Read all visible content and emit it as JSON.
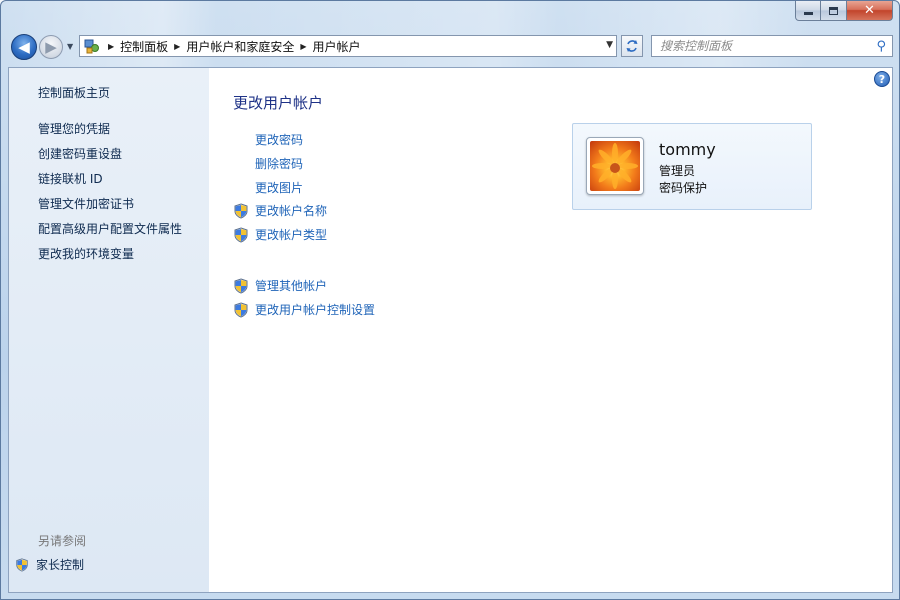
{
  "window": {
    "caption": {
      "minimize_icon": "minimize-icon",
      "maximize_icon": "maximize-icon",
      "close_icon": "close-icon",
      "close_glyph": "✕"
    }
  },
  "nav": {
    "back_glyph": "◀",
    "forward_glyph": "▶",
    "history_glyph": "▼"
  },
  "address": {
    "crumbs": [
      "控制面板",
      "用户帐户和家庭安全",
      "用户帐户"
    ],
    "separator": "▶",
    "dropdown_glyph": "▼"
  },
  "search": {
    "placeholder": "搜索控制面板",
    "icon_glyph": "⚲"
  },
  "sidebar": {
    "home": "控制面板主页",
    "links": [
      "管理您的凭据",
      "创建密码重设盘",
      "链接联机 ID",
      "管理文件加密证书",
      "配置高级用户配置文件属性",
      "更改我的环境变量"
    ],
    "see_also": "另请参阅",
    "parental_controls": "家长控制"
  },
  "help": {
    "glyph": "?"
  },
  "main": {
    "title": "更改用户帐户",
    "tasks": [
      {
        "label": "更改密码",
        "shield": false
      },
      {
        "label": "删除密码",
        "shield": false
      },
      {
        "label": "更改图片",
        "shield": false
      },
      {
        "label": "更改帐户名称",
        "shield": true
      },
      {
        "label": "更改帐户类型",
        "shield": true
      }
    ],
    "other_tasks": [
      {
        "label": "管理其他帐户",
        "shield": true
      },
      {
        "label": "更改用户帐户控制设置",
        "shield": true
      }
    ]
  },
  "user": {
    "name": "tommy",
    "role": "管理员",
    "password_status": "密码保护"
  },
  "colors": {
    "link": "#1f64b8",
    "title": "#1e3287",
    "sidebar_text": "#0e2a4f",
    "accent": "#2e6dc3"
  }
}
